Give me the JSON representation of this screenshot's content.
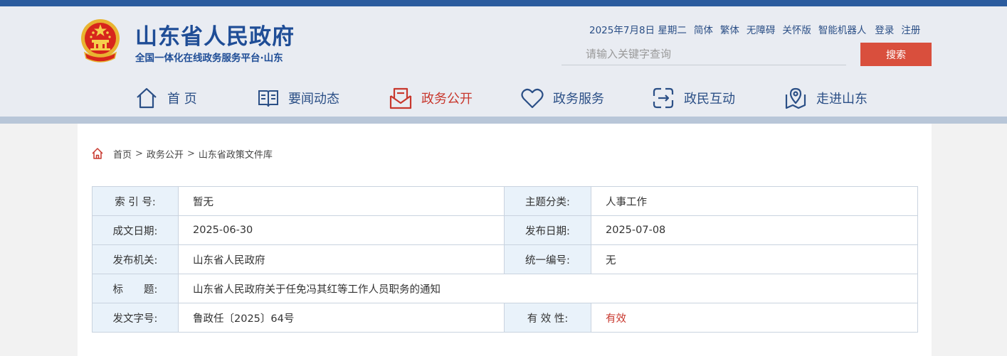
{
  "site": {
    "title": "山东省人民政府",
    "subtitle": "全国一体化在线政务服务平台·山东"
  },
  "toplinks": {
    "date": "2025年7月8日",
    "weekday": "星期二",
    "simplified": "简体",
    "traditional": "繁体",
    "accessible": "无障碍",
    "elder": "关怀版",
    "robot": "智能机器人",
    "login": "登录",
    "register": "注册"
  },
  "search": {
    "placeholder": "请输入关键字查询",
    "button": "搜索"
  },
  "nav": [
    {
      "label": "首 页",
      "icon": "home-icon"
    },
    {
      "label": "要闻动态",
      "icon": "book-icon"
    },
    {
      "label": "政务公开",
      "icon": "mail-icon",
      "active": true
    },
    {
      "label": "政务服务",
      "icon": "heart-icon"
    },
    {
      "label": "政民互动",
      "icon": "exchange-icon"
    },
    {
      "label": "走进山东",
      "icon": "map-pin-icon"
    }
  ],
  "breadcrumb": [
    "首页",
    "政务公开",
    "山东省政策文件库"
  ],
  "meta": {
    "rows": [
      {
        "k1": "索 引 号:",
        "v1": "暂无",
        "k2": "主题分类:",
        "v2": "人事工作"
      },
      {
        "k1": "成文日期:",
        "v1": "2025-06-30",
        "k2": "发布日期:",
        "v2": "2025-07-08"
      },
      {
        "k1": "发布机关:",
        "v1": "山东省人民政府",
        "k2": "统一编号:",
        "v2": "无"
      },
      {
        "k1": "标　　题:",
        "v1": "山东省人民政府关于任免冯其红等工作人员职务的通知"
      },
      {
        "k1": "发文字号:",
        "v1": "鲁政任〔2025〕64号",
        "k2": "有 效 性:",
        "v2": "有效"
      }
    ]
  },
  "colors": {
    "brand_blue": "#1f4d96",
    "accent_red": "#c8372d",
    "search_red": "#d94f3d",
    "header_bg": "#e9ecf2",
    "key_cell_bg": "#e9f2fa"
  }
}
